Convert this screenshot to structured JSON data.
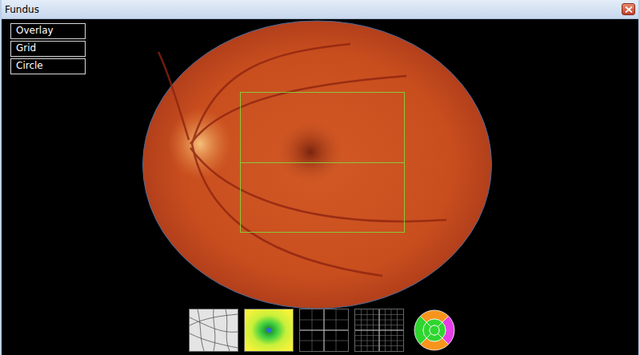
{
  "window": {
    "title": "Fundus"
  },
  "toolbar": {
    "buttons": [
      {
        "label": "Overlay"
      },
      {
        "label": "Grid"
      },
      {
        "label": "Circle"
      }
    ]
  },
  "overlay": {
    "rows": 2
  },
  "thumbnails": [
    {
      "kind": "vessel-map"
    },
    {
      "kind": "thickness-map"
    },
    {
      "kind": "grid"
    },
    {
      "kind": "fine-grid"
    },
    {
      "kind": "sector-map"
    }
  ],
  "sectors": [
    {
      "ring": "outer",
      "position": "top",
      "color": "#f7941d"
    },
    {
      "ring": "outer",
      "position": "right",
      "color": "#e63ee6"
    },
    {
      "ring": "outer",
      "position": "bottom",
      "color": "#f7941d"
    },
    {
      "ring": "outer",
      "position": "left",
      "color": "#2fd62f"
    },
    {
      "ring": "inner",
      "position": "top",
      "color": "#2fd62f"
    },
    {
      "ring": "inner",
      "position": "right",
      "color": "#2fd62f"
    },
    {
      "ring": "inner",
      "position": "bottom",
      "color": "#2fd62f"
    },
    {
      "ring": "inner",
      "position": "left",
      "color": "#2fd62f"
    },
    {
      "ring": "center",
      "position": "center",
      "color": "#2fd62f"
    }
  ]
}
